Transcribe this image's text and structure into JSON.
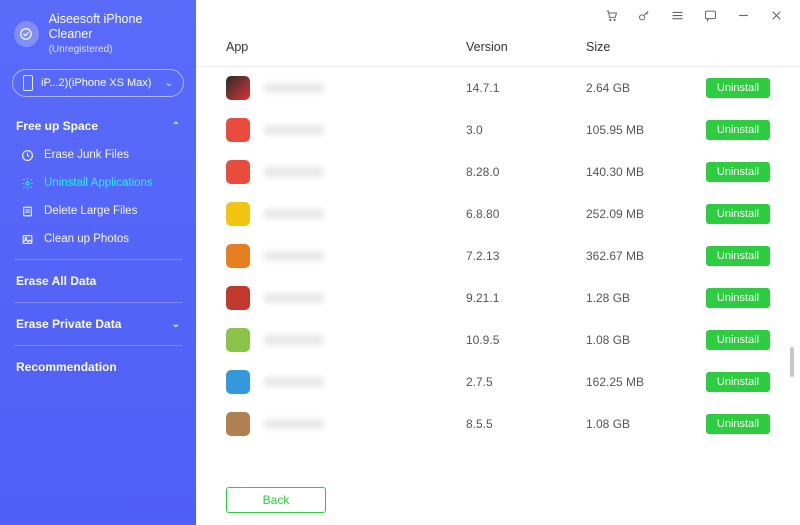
{
  "brand": {
    "title": "Aiseesoft iPhone Cleaner",
    "subtitle": "(Unregistered)"
  },
  "device": {
    "label": "iP...2)(iPhone XS Max)"
  },
  "sidebar": {
    "freeUpSpace": "Free up Space",
    "items": {
      "eraseJunk": "Erase Junk Files",
      "uninstallApps": "Uninstall Applications",
      "deleteLarge": "Delete Large Files",
      "cleanPhotos": "Clean up Photos"
    },
    "eraseAll": "Erase All Data",
    "erasePrivate": "Erase Private Data",
    "recommendation": "Recommendation"
  },
  "table": {
    "headers": {
      "app": "App",
      "version": "Version",
      "size": "Size"
    },
    "uninstallLabel": "Uninstall",
    "rows": [
      {
        "version": "14.7.1",
        "size": "2.64 GB"
      },
      {
        "version": "3.0",
        "size": "105.95 MB"
      },
      {
        "version": "8.28.0",
        "size": "140.30 MB"
      },
      {
        "version": "6.8.80",
        "size": "252.09 MB"
      },
      {
        "version": "7.2.13",
        "size": "362.67 MB"
      },
      {
        "version": "9.21.1",
        "size": "1.28 GB"
      },
      {
        "version": "10.9.5",
        "size": "1.08 GB"
      },
      {
        "version": "2.7.5",
        "size": "162.25 MB"
      },
      {
        "version": "8.5.5",
        "size": "1.08 GB"
      }
    ]
  },
  "footer": {
    "back": "Back"
  }
}
